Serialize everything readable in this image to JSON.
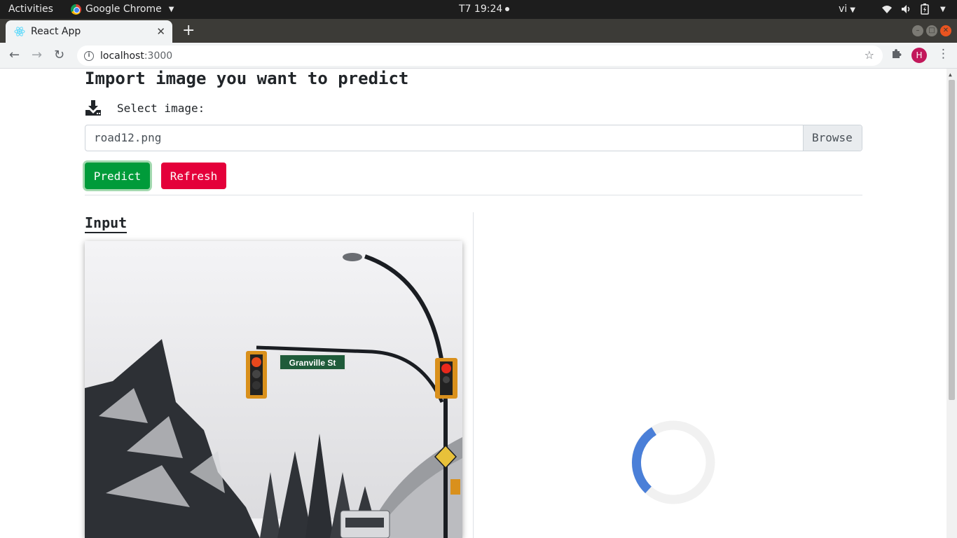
{
  "system_bar": {
    "activities": "Activities",
    "app_name": "Google Chrome",
    "clock": "T7 19:24",
    "lang": "vi"
  },
  "browser": {
    "tab_title": "React App",
    "url_host": "localhost",
    "url_port": ":3000",
    "avatar_letter": "H"
  },
  "page": {
    "heading": "Import image you want to predict",
    "select_label": "Select image:",
    "file_name": "road12.png",
    "browse_label": "Browse",
    "predict_label": "Predict",
    "refresh_label": "Refresh",
    "input_title": "Input",
    "photo_sign_text": "Granville St"
  },
  "colors": {
    "predict": "#009b3a",
    "refresh": "#e4003a",
    "spinner": "#4a7fd8"
  }
}
